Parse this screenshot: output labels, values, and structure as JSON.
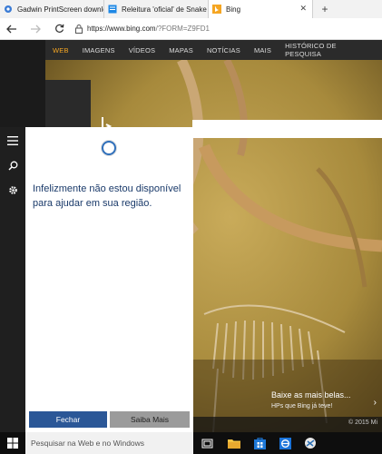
{
  "browser": {
    "tabs": [
      {
        "label": "Gadwin PrintScreen download",
        "icon": "gadwin-icon"
      },
      {
        "label": "Releitura 'oficial' de Snake cheg",
        "icon": "page-icon"
      },
      {
        "label": "Bing",
        "icon": "bing-icon",
        "active": true
      }
    ],
    "close_glyph": "✕",
    "newtab_glyph": "+",
    "url_main": "https://www.bing.com",
    "url_rest": "/?FORM=Z9FD1"
  },
  "bing": {
    "nav": [
      "WEB",
      "IMAGENS",
      "VÍDEOS",
      "MAPAS",
      "NOTÍCIAS",
      "MAIS",
      "HISTÓRICO DE PESQUISA"
    ],
    "active_nav": "WEB",
    "caption_title": "Baixe as mais belas...",
    "caption_sub": "HPs que Bing já teve!",
    "copyright": "© 2015 Mi",
    "accent": "#f5a623"
  },
  "cortana": {
    "message": "Infelizmente não estou disponível para ajudar em sua região.",
    "close_button": "Fechar",
    "learn_more_button": "Saiba Mais",
    "accent": "#2b5797"
  },
  "taskbar": {
    "search_placeholder": "Pesquisar na Web e no Windows",
    "icons": [
      "task-view-icon",
      "file-explorer-icon",
      "store-icon",
      "edge-icon",
      "app-icon"
    ]
  }
}
